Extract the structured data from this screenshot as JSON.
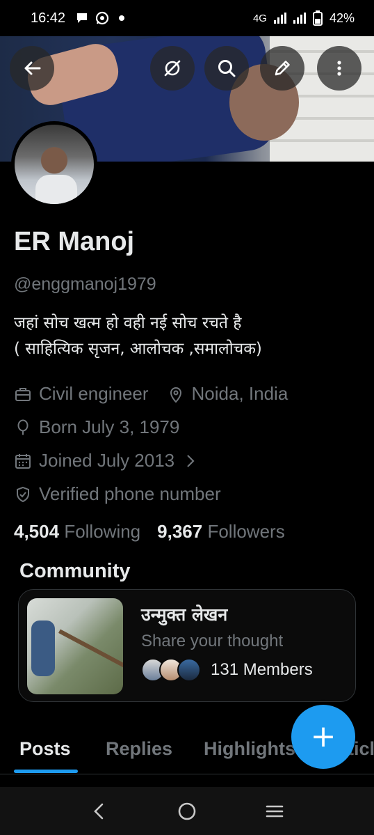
{
  "status_bar": {
    "time": "16:42",
    "network": "4G",
    "battery": "42%",
    "notification_icons": [
      "chat-icon",
      "whatsapp-icon",
      "dot-icon"
    ]
  },
  "header": {
    "buttons": [
      "back-arrow-icon",
      "grok-icon",
      "search-icon",
      "edit-icon",
      "more-vert-icon"
    ]
  },
  "profile": {
    "name": "ER Manoj",
    "handle": "@enggmanoj1979",
    "bio_line1": "जहां सोच खत्म हो वही नई सोच रचते है",
    "bio_line2": "( साहित्यिक सृजन, आलोचक ,समालोचक)",
    "profession": "Civil engineer",
    "location": "Noida, India",
    "born": "Born July 3, 1979",
    "joined": "Joined July 2013",
    "verified": "Verified phone number",
    "following_count": "4,504",
    "following_label": "Following",
    "followers_count": "9,367",
    "followers_label": "Followers"
  },
  "community": {
    "section_title": "Community",
    "name": "उन्मुक्त लेखन",
    "description": "Share your thought",
    "members": "131 Members"
  },
  "tabs": [
    "Posts",
    "Replies",
    "Highlights",
    "Articles"
  ],
  "fab_label": "+",
  "colors": {
    "accent": "#1d9bf0",
    "text_primary": "#e7e9ea",
    "text_secondary": "#71767b",
    "border": "#2f3336"
  }
}
